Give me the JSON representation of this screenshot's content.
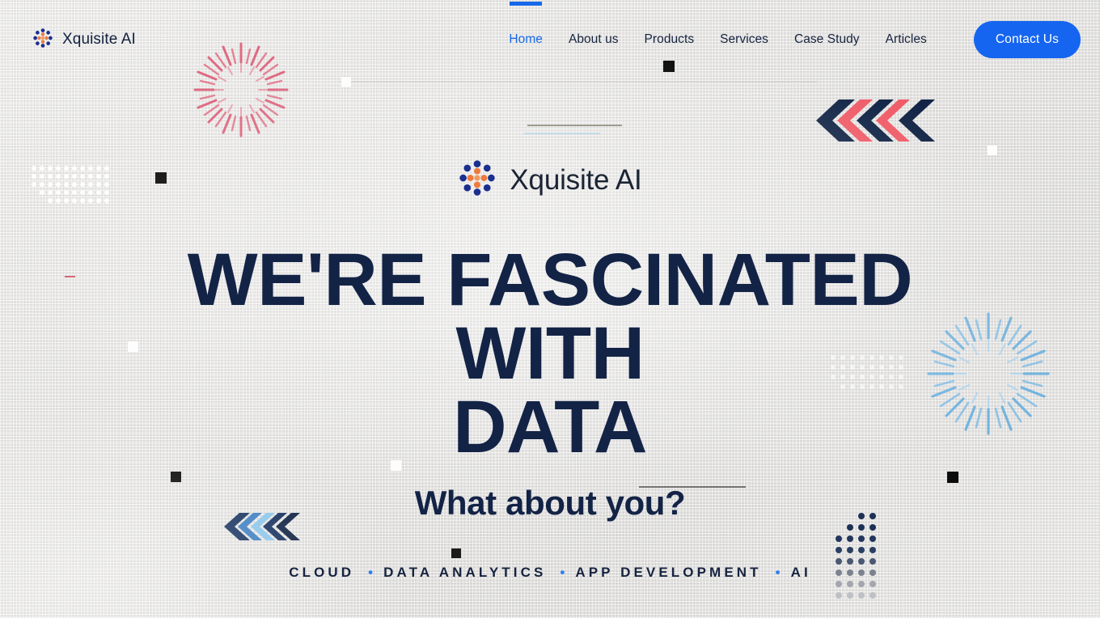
{
  "brand": {
    "name": "Xquisite AI",
    "logo_icon": "dot-cluster-logo",
    "logo_outer_color": "#1b2f8f",
    "logo_inner_color": "#ef7a3d"
  },
  "header": {
    "nav": [
      {
        "label": "Home",
        "active": true
      },
      {
        "label": "About us",
        "active": false
      },
      {
        "label": "Products",
        "active": false
      },
      {
        "label": "Services",
        "active": false
      },
      {
        "label": "Case Study",
        "active": false
      },
      {
        "label": "Articles",
        "active": false
      }
    ],
    "cta_label": "Contact Us",
    "active_color": "#1769e8",
    "cta_bg": "#1565f0",
    "nav_text_color": "#16233f"
  },
  "hero": {
    "logo_name": "Xquisite AI",
    "headline_line1": "WE'RE FASCINATED WITH",
    "headline_line2": "DATA",
    "subhead": "What about you?",
    "headline_color": "#132346",
    "tagline": {
      "items": [
        "CLOUD",
        "DATA ANALYTICS",
        "APP DEVELOPMENT",
        "AI"
      ],
      "separator": "•",
      "separator_color": "#2f7ef0"
    }
  },
  "decor": {
    "background_color": "#e6e5e3",
    "burst_pink_color": "#e0566f",
    "burst_blue_color": "#5aa9e0",
    "chevron_navy": "#122546",
    "chevron_coral": "#ef5c68",
    "chevron_blue_dark": "#17325e",
    "chevron_blue_light": "#6fb4e4",
    "dotgrid_white": "#ffffff",
    "dotgrid_navy": "#1d3055",
    "square_black": "#0a0a0a",
    "line_color": "#7d7a6a"
  }
}
